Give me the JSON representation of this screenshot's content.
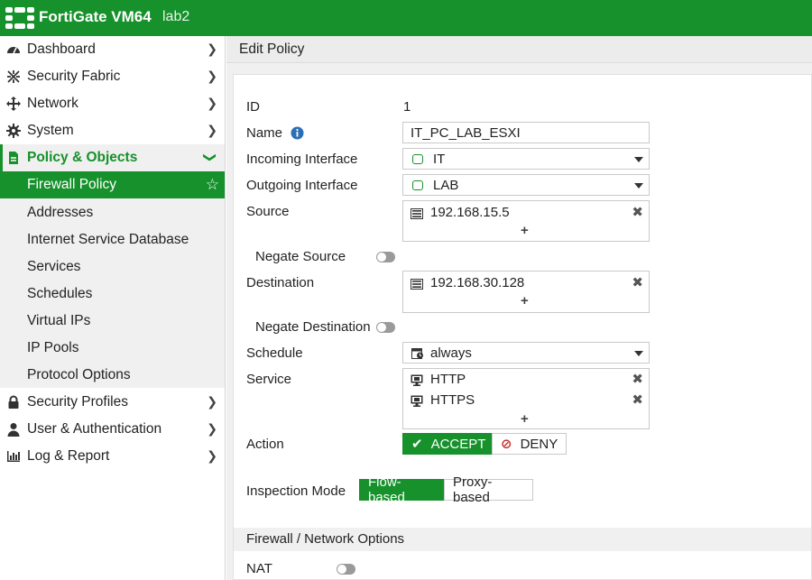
{
  "topbar": {
    "brand": "FortiGate VM64",
    "hostname": "lab2",
    "color": "#16912b"
  },
  "sidebar": {
    "items": [
      {
        "label": "Dashboard",
        "icon": "dashboard-icon"
      },
      {
        "label": "Security Fabric",
        "icon": "fabric-icon"
      },
      {
        "label": "Network",
        "icon": "network-icon"
      },
      {
        "label": "System",
        "icon": "gear-icon"
      },
      {
        "label": "Policy & Objects",
        "icon": "policy-icon"
      },
      {
        "label": "Security Profiles",
        "icon": "lock-icon"
      },
      {
        "label": "User & Authentication",
        "icon": "user-icon"
      },
      {
        "label": "Log & Report",
        "icon": "chart-icon"
      }
    ],
    "subitems": [
      {
        "label": "Firewall Policy"
      },
      {
        "label": "Addresses"
      },
      {
        "label": "Internet Service Database"
      },
      {
        "label": "Services"
      },
      {
        "label": "Schedules"
      },
      {
        "label": "Virtual IPs"
      },
      {
        "label": "IP Pools"
      },
      {
        "label": "Protocol Options"
      }
    ]
  },
  "page": {
    "title": "Edit Policy"
  },
  "form": {
    "id_label": "ID",
    "id_value": "1",
    "name_label": "Name",
    "name_value": "IT_PC_LAB_ESXI",
    "incoming_label": "Incoming Interface",
    "incoming_value": "IT",
    "outgoing_label": "Outgoing Interface",
    "outgoing_value": "LAB",
    "source_label": "Source",
    "source_entries": [
      "192.168.15.5"
    ],
    "negate_source_label": "Negate Source",
    "destination_label": "Destination",
    "destination_entries": [
      "192.168.30.128"
    ],
    "negate_destination_label": "Negate Destination",
    "schedule_label": "Schedule",
    "schedule_value": "always",
    "service_label": "Service",
    "service_entries": [
      "HTTP",
      "HTTPS"
    ],
    "add_symbol": "+",
    "remove_symbol": "✖",
    "action_label": "Action",
    "action_accept": "ACCEPT",
    "action_deny": "DENY",
    "action_selected": "ACCEPT",
    "inspection_label": "Inspection Mode",
    "inspection_flow": "Flow-based",
    "inspection_proxy": "Proxy-based",
    "inspection_selected": "Flow-based",
    "section_title": "Firewall / Network Options",
    "nat_label": "NAT"
  }
}
